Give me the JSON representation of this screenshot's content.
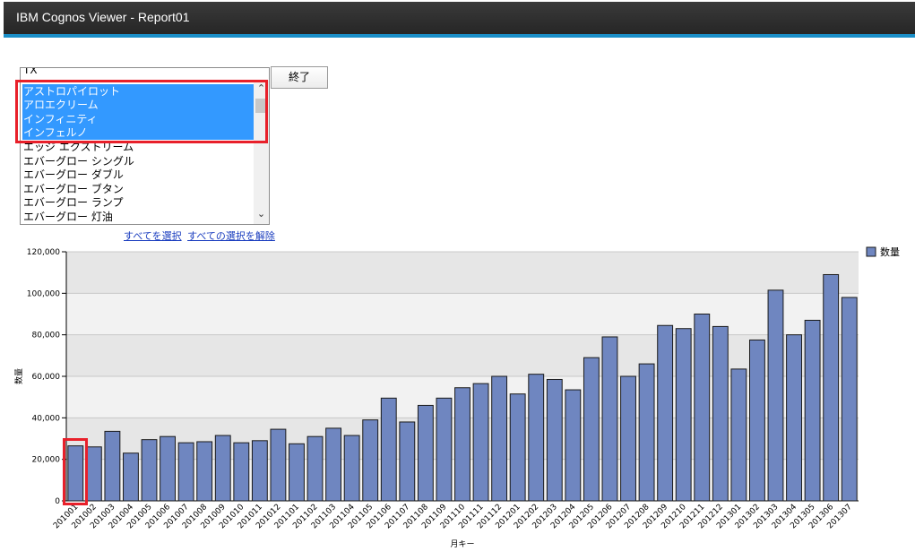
{
  "window": {
    "title": "IBM Cognos Viewer - Report01"
  },
  "filter": {
    "listbox": {
      "header_value": "TX",
      "options": [
        {
          "label": "アストロパイロット",
          "selected": true
        },
        {
          "label": "アロエクリーム",
          "selected": true
        },
        {
          "label": "インフィニティ",
          "selected": true
        },
        {
          "label": "インフェルノ",
          "selected": true
        },
        {
          "label": "エッジ エクストリーム",
          "selected": false
        },
        {
          "label": "エバーグロー シングル",
          "selected": false
        },
        {
          "label": "エバーグロー ダブル",
          "selected": false
        },
        {
          "label": "エバーグロー ブタン",
          "selected": false
        },
        {
          "label": "エバーグロー ランプ",
          "selected": false
        },
        {
          "label": "エバーグロー 灯油",
          "selected": false
        }
      ]
    },
    "finish_button": "終了",
    "select_all_link": "すべてを選択",
    "deselect_all_link": "すべての選択を解除"
  },
  "chart_data": {
    "type": "bar",
    "xlabel": "月キー",
    "ylabel": "数量",
    "ylim": [
      0,
      120000
    ],
    "yticks": [
      "0",
      "20,000",
      "40,000",
      "60,000",
      "80,000",
      "100,000",
      "120,000"
    ],
    "ytick_values": [
      0,
      20000,
      40000,
      60000,
      80000,
      100000,
      120000
    ],
    "legend": "top-right",
    "bar_color": "#6f86c0",
    "categories": [
      "201001",
      "201002",
      "201003",
      "201004",
      "201005",
      "201006",
      "201007",
      "201008",
      "201009",
      "201010",
      "201011",
      "201012",
      "201101",
      "201102",
      "201103",
      "201104",
      "201105",
      "201106",
      "201107",
      "201108",
      "201109",
      "201110",
      "201111",
      "201112",
      "201201",
      "201202",
      "201203",
      "201204",
      "201205",
      "201206",
      "201207",
      "201208",
      "201209",
      "201210",
      "201211",
      "201212",
      "201301",
      "201302",
      "201303",
      "201304",
      "201305",
      "201306",
      "201307"
    ],
    "series": [
      {
        "name": "数量",
        "values": [
          26500,
          26000,
          33500,
          23000,
          29500,
          31000,
          28000,
          28500,
          31500,
          28000,
          29000,
          34500,
          27500,
          31000,
          35000,
          31500,
          39000,
          49500,
          38000,
          46000,
          49500,
          54500,
          56500,
          60000,
          51500,
          61000,
          58500,
          53500,
          69000,
          79000,
          60000,
          66000,
          84500,
          83000,
          90000,
          84000,
          63500,
          77500,
          101500,
          80000,
          87000,
          109000,
          98000
        ]
      }
    ]
  }
}
